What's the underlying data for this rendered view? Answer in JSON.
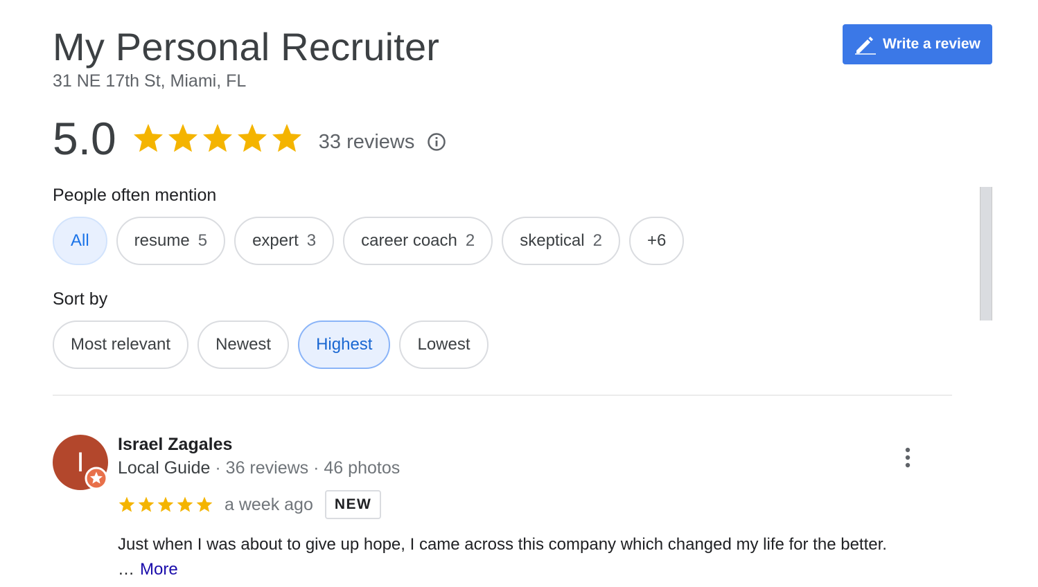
{
  "place": {
    "name": "My Personal Recruiter",
    "address": "31 NE 17th St, Miami, FL"
  },
  "actions": {
    "write_review_label": "Write a review"
  },
  "summary": {
    "rating": "5.0",
    "stars": 5,
    "review_count_label": "33 reviews"
  },
  "mentions": {
    "label": "People often mention",
    "chips": [
      {
        "label": "All",
        "count": ""
      },
      {
        "label": "resume",
        "count": "5"
      },
      {
        "label": "expert",
        "count": "3"
      },
      {
        "label": "career coach",
        "count": "2"
      },
      {
        "label": "skeptical",
        "count": "2"
      },
      {
        "label": "+6",
        "count": ""
      }
    ],
    "selected": "All"
  },
  "sort": {
    "label": "Sort by",
    "options": [
      "Most relevant",
      "Newest",
      "Highest",
      "Lowest"
    ],
    "selected": "Highest"
  },
  "review": {
    "author_initial": "I",
    "author_name": "Israel Zagales",
    "guide_label": "Local Guide",
    "author_reviews": "36 reviews",
    "author_photos": "46 photos",
    "separator": "·",
    "stars": 5,
    "date": "a week ago",
    "badge": "NEW",
    "text": "Just when I was about to give up hope, I came across this company which changed my life for the better.",
    "ellipsis": "…",
    "more_label": "More"
  },
  "colors": {
    "star": "#f4b400",
    "accent": "#3b78e7",
    "avatar_bg": "#b3472c",
    "link": "#1a0dab"
  },
  "icons": {
    "write": "pencil-icon",
    "info": "info-icon",
    "menu": "more-vert-icon",
    "badge": "local-guide-star-icon"
  }
}
